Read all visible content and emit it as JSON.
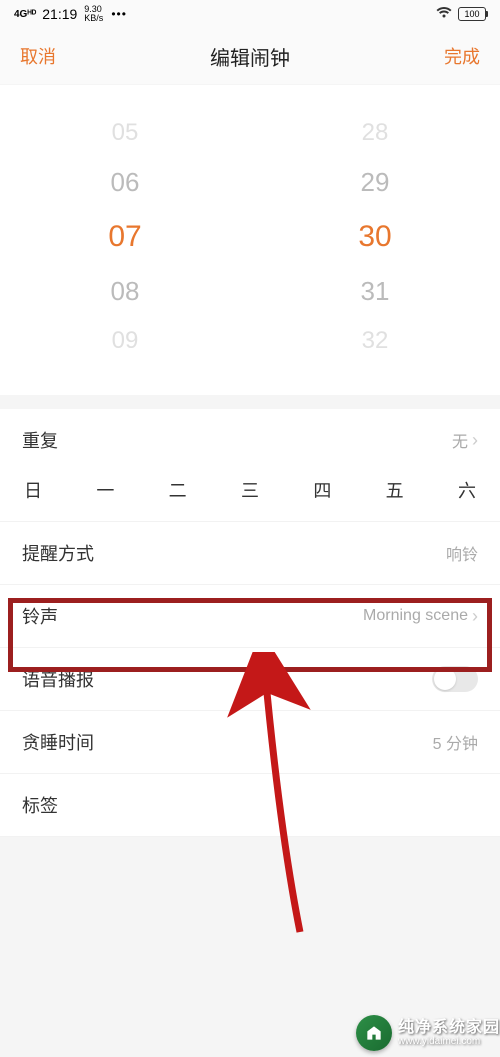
{
  "status": {
    "network": "4Gᴴᴰ",
    "time": "21:19",
    "speed_top": "9.30",
    "speed_bot": "KB/s",
    "dots": "•••",
    "battery": "100"
  },
  "nav": {
    "cancel": "取消",
    "title": "编辑闹钟",
    "done": "完成"
  },
  "picker": {
    "hours": [
      "05",
      "06",
      "07",
      "08",
      "09"
    ],
    "minutes": [
      "28",
      "29",
      "30",
      "31",
      "32"
    ]
  },
  "rows": {
    "repeat": {
      "label": "重复",
      "value": "无"
    },
    "weekdays": [
      "日",
      "一",
      "二",
      "三",
      "四",
      "五",
      "六"
    ],
    "remind": {
      "label": "提醒方式",
      "value": "响铃"
    },
    "ringtone": {
      "label": "铃声",
      "value": "Morning scene"
    },
    "voice": {
      "label": "语音播报"
    },
    "snooze": {
      "label": "贪睡时间",
      "value": "5 分钟"
    },
    "tag": {
      "label": "标签"
    }
  },
  "watermark": {
    "cn": "纯净系统家园",
    "url": "www.yidaimei.com"
  }
}
